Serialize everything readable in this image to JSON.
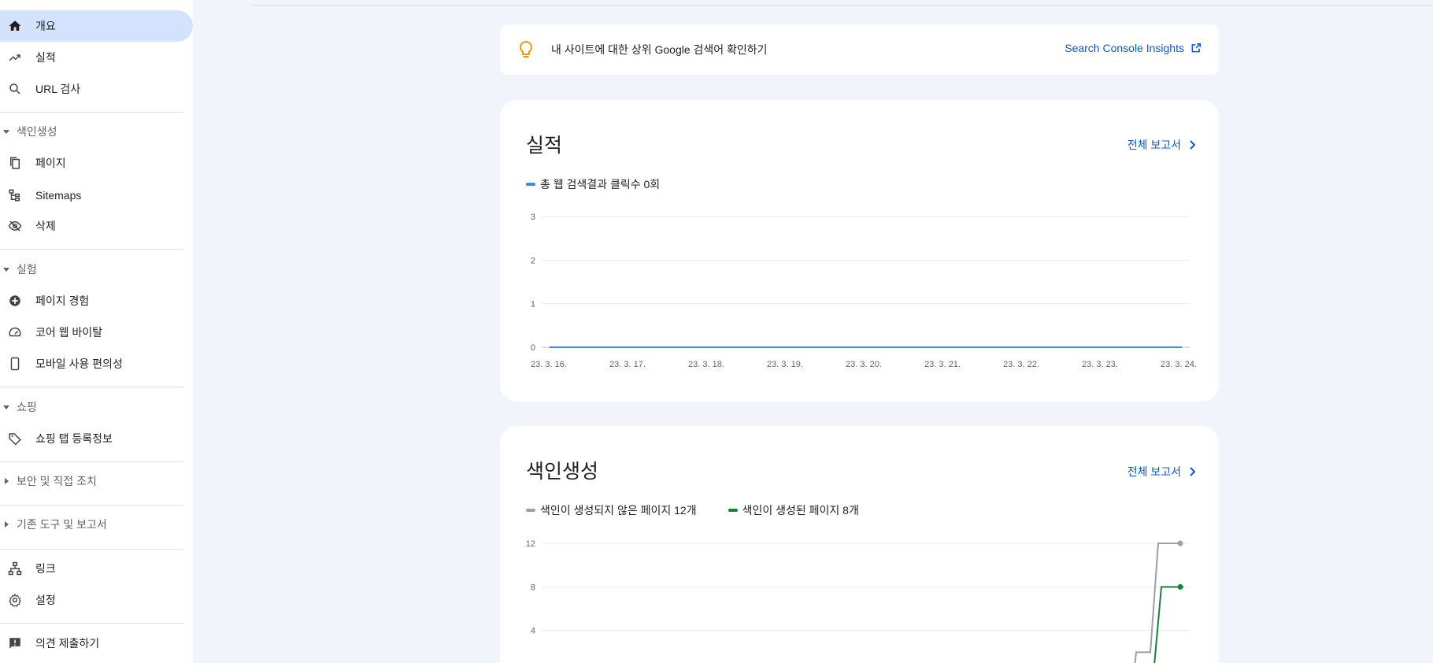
{
  "sidebar": {
    "items": [
      {
        "label": "개요",
        "icon": "home-icon",
        "active": true
      },
      {
        "label": "실적",
        "icon": "trending-up-icon"
      },
      {
        "label": "URL 검사",
        "icon": "search-icon"
      },
      {
        "label": "페이지",
        "icon": "pages-icon"
      },
      {
        "label": "Sitemaps",
        "icon": "sitemap-icon"
      },
      {
        "label": "삭제",
        "icon": "visibility-off-icon"
      },
      {
        "label": "페이지 경험",
        "icon": "plus-circle-icon"
      },
      {
        "label": "코어 웹 바이탈",
        "icon": "speed-icon"
      },
      {
        "label": "모바일 사용 편의성",
        "icon": "phone-icon"
      },
      {
        "label": "쇼핑 탭 등록정보",
        "icon": "tag-icon"
      },
      {
        "label": "링크",
        "icon": "links-icon"
      },
      {
        "label": "설정",
        "icon": "gear-icon"
      },
      {
        "label": "의견 제출하기",
        "icon": "feedback-icon"
      }
    ],
    "sections": [
      {
        "label": "색인생성",
        "expanded": true
      },
      {
        "label": "실험",
        "expanded": true
      },
      {
        "label": "쇼핑",
        "expanded": true
      },
      {
        "label": "보안 및 직접 조치",
        "expanded": false
      },
      {
        "label": "기존 도구 및 보고서",
        "expanded": false
      }
    ]
  },
  "banner": {
    "text": "내 사이트에 대한 상위 Google 검색어 확인하기",
    "link": "Search Console Insights"
  },
  "performance": {
    "title": "실적",
    "full_report": "전체 보고서",
    "legend": "총 웹 검색결과 클릭수 0회"
  },
  "indexing": {
    "title": "색인생성",
    "full_report": "전체 보고서",
    "legend_not_indexed": "색인이 생성되지 않은 페이지 12개",
    "legend_indexed": "색인이 생성된 페이지 8개"
  },
  "colors": {
    "accent": "#0b57d0",
    "clicks": "#4285f4",
    "not_indexed": "#9aa0a6",
    "indexed": "#188038",
    "active_nav": "#d3e3fd"
  },
  "chart_data": [
    {
      "type": "line",
      "categories": [
        "23. 3. 16.",
        "23. 3. 17.",
        "23. 3. 18.",
        "23. 3. 19.",
        "23. 3. 20.",
        "23. 3. 21.",
        "23. 3. 22.",
        "23. 3. 23.",
        "23. 3. 24."
      ],
      "yticks": [
        0,
        1,
        2,
        3
      ],
      "ylim": [
        0,
        3
      ],
      "series": [
        {
          "name": "총 웹 검색결과 클릭수 0회",
          "values": [
            0,
            0,
            0,
            0,
            0,
            0,
            0,
            0,
            0
          ],
          "color": "#4285f4"
        }
      ],
      "grid": true
    },
    {
      "type": "line",
      "yticks": [
        4,
        8,
        12
      ],
      "ylim": [
        0,
        12
      ],
      "series": [
        {
          "name": "색인이 생성되지 않은 페이지 12개",
          "values": [
            0,
            2,
            2,
            12,
            12
          ],
          "color": "#9aa0a6"
        },
        {
          "name": "색인이 생성된 페이지 8개",
          "values": [
            0,
            0,
            0,
            8,
            8
          ],
          "color": "#188038"
        }
      ],
      "grid": true
    }
  ]
}
